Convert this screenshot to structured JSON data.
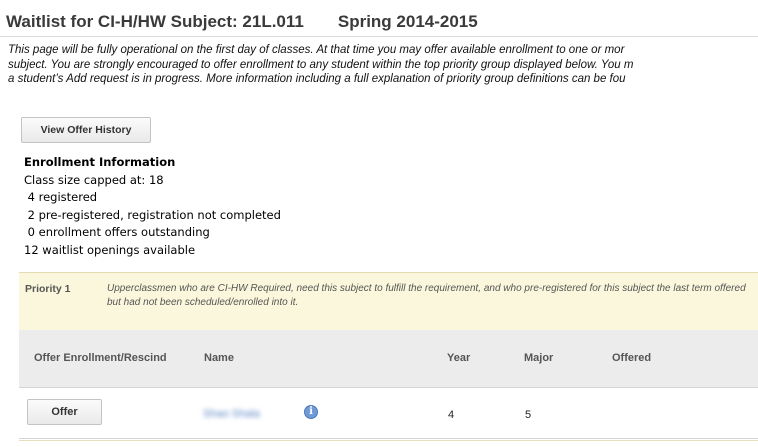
{
  "header": {
    "title": "Waitlist for CI-H/HW Subject: 21L.011",
    "term": "Spring 2014-2015"
  },
  "intro": {
    "lines": [
      "This page will be fully operational on the first day of classes. At that time you may offer available enrollment to one or mor",
      "subject. You are strongly encouraged to offer enrollment to any student within the top priority group displayed below. You m",
      "a student’s Add request is in progress. More information including a full explanation of priority group definitions can be fou"
    ]
  },
  "toolbar": {
    "history_label": "View Offer History"
  },
  "enrollment": {
    "heading": "Enrollment Information",
    "lines": [
      "Class size capped at: 18",
      " 4 registered",
      " 2 pre-registered, registration not completed",
      " 0 enrollment offers outstanding",
      "12 waitlist openings available"
    ]
  },
  "priority": {
    "label": "Priority 1",
    "description": "Upperclassmen who are CI-HW Required, need this subject to fulfill the requirement, and who pre-registered for this subject the last term offered but had not been scheduled/enrolled into it."
  },
  "table": {
    "columns": [
      "Offer Enrollment/Rescind",
      "Name",
      "Year",
      "Major",
      "Offered"
    ],
    "rows": [
      {
        "action": "Offer",
        "name": "Shao Shala",
        "year": "4",
        "major": "5",
        "offered": ""
      }
    ]
  },
  "icons": {
    "info": "info-icon"
  }
}
